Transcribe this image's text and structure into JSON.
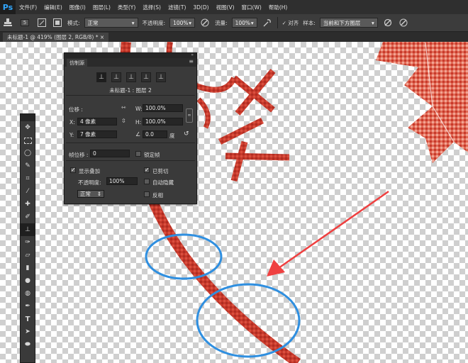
{
  "app": {
    "logo": "Ps"
  },
  "menu": [
    "文件(F)",
    "编辑(E)",
    "图像(I)",
    "图层(L)",
    "类型(Y)",
    "选择(S)",
    "滤镜(T)",
    "3D(D)",
    "视图(V)",
    "窗口(W)",
    "帮助(H)"
  ],
  "options": {
    "brush_size": "5",
    "mode_label": "模式:",
    "mode_value": "正常",
    "opacity_label": "不透明度:",
    "opacity_value": "100%",
    "flow_label": "流量:",
    "flow_value": "100%",
    "align_label": "对齐",
    "sample_label": "样本:",
    "sample_value": "当前和下方图层"
  },
  "document_tab": "未标题-1 @ 419% (图层 2, RGB/8) * ×",
  "clone_panel": {
    "tab_label": "仿制源",
    "source_name": "未标题-1 : 图层 2",
    "offset_label": "位移 :",
    "w_label": "W:",
    "w_value": "100.0%",
    "h_label": "H:",
    "h_value": "100.0%",
    "x_label": "X:",
    "x_value": "4 像素",
    "y_label": "Y:",
    "y_value": "7 像素",
    "angle_value": "0.0",
    "angle_unit": "度",
    "frame_offset_label": "帧位移 :",
    "frame_offset_value": "0",
    "lock_frame_label": "锁定帧",
    "show_overlay_label": "显示叠加",
    "clipped_label": "已剪切",
    "opacity_label": "不透明度:",
    "opacity_value": "100%",
    "auto_hide_label": "自动隐藏",
    "blend_mode": "正常",
    "invert_label": "反相"
  },
  "colors": {
    "stroke_red": "#c8392b",
    "annotation_blue": "#2f8fe0",
    "arrow_red": "#ef4040",
    "panel_bg": "#3a3a3a",
    "menubar_bg": "#2f2f2f"
  },
  "tools": [
    "move-icon",
    "marquee-icon",
    "lasso-icon",
    "quick-select-icon",
    "crop-icon",
    "eyedropper-icon",
    "healing-icon",
    "brush-icon",
    "clone-stamp-icon",
    "history-brush-icon",
    "eraser-icon",
    "gradient-icon",
    "blur-icon",
    "dodge-icon",
    "pen-icon",
    "type-icon",
    "path-select-icon",
    "shape-icon"
  ]
}
